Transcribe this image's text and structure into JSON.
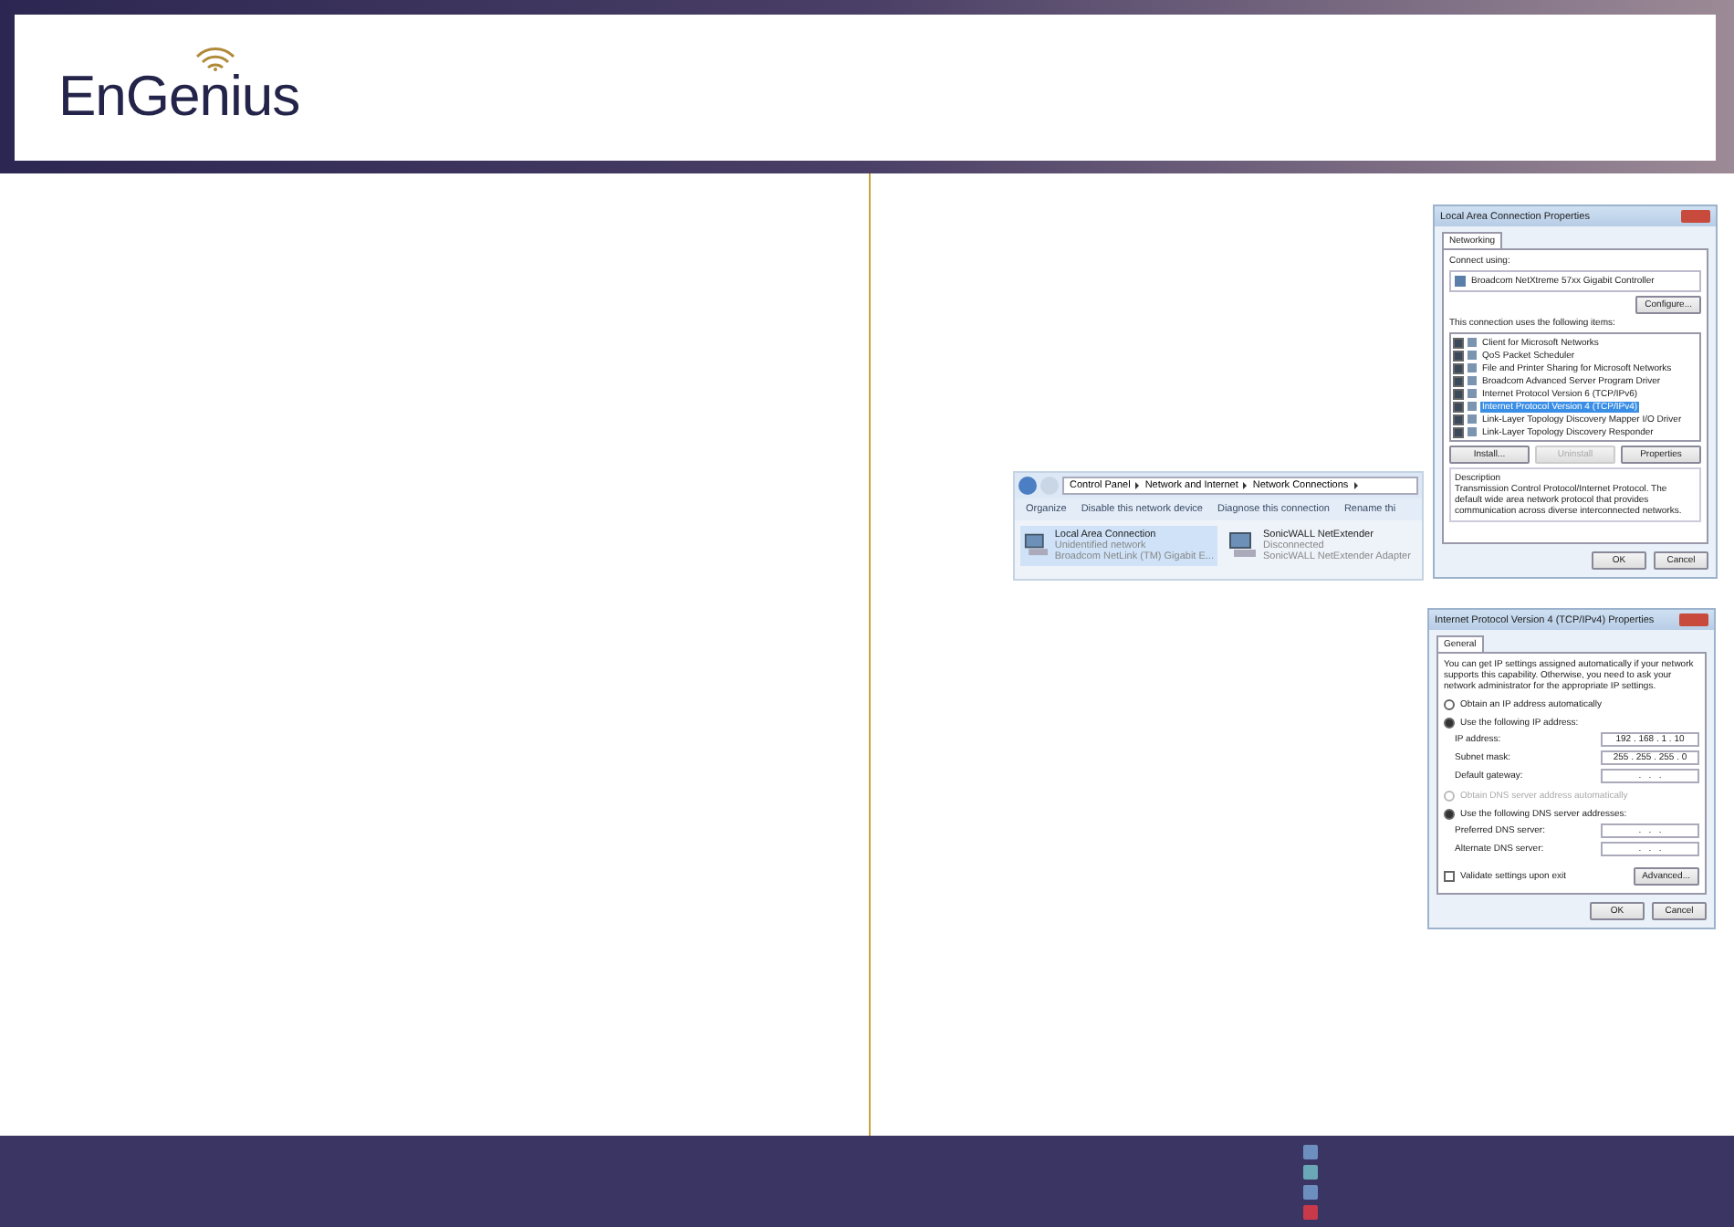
{
  "header": {
    "logo": "EnGenius"
  },
  "network_connections": {
    "breadcrumb": [
      "Control Panel",
      "Network and Internet",
      "Network Connections"
    ],
    "toolbar": [
      "Organize",
      "Disable this network device",
      "Diagnose this connection",
      "Rename thi"
    ],
    "connections": [
      {
        "name": "Local Area Connection",
        "status": "Unidentified network",
        "adapter": "Broadcom NetLink (TM) Gigabit E...",
        "selected": true
      },
      {
        "name": "SonicWALL NetExtender",
        "status": "Disconnected",
        "adapter": "SonicWALL NetExtender Adapter",
        "selected": false
      }
    ]
  },
  "lan_properties": {
    "title": "Local Area Connection Properties",
    "tabs": [
      {
        "label": "Networking",
        "selected": true
      }
    ],
    "connect_using_label": "Connect using:",
    "adapter": "Broadcom NetXtreme 57xx Gigabit Controller",
    "configure_button": "Configure...",
    "items_label": "This connection uses the following items:",
    "items": [
      {
        "label": "Client for Microsoft Networks",
        "checked": true,
        "selected": false
      },
      {
        "label": "QoS Packet Scheduler",
        "checked": true,
        "selected": false
      },
      {
        "label": "File and Printer Sharing for Microsoft Networks",
        "checked": true,
        "selected": false
      },
      {
        "label": "Broadcom Advanced Server Program Driver",
        "checked": true,
        "selected": false
      },
      {
        "label": "Internet Protocol Version 6 (TCP/IPv6)",
        "checked": true,
        "selected": false
      },
      {
        "label": "Internet Protocol Version 4 (TCP/IPv4)",
        "checked": true,
        "selected": true
      },
      {
        "label": "Link-Layer Topology Discovery Mapper I/O Driver",
        "checked": true,
        "selected": false
      },
      {
        "label": "Link-Layer Topology Discovery Responder",
        "checked": true,
        "selected": false
      }
    ],
    "buttons": [
      {
        "label": "Install...",
        "disabled": false
      },
      {
        "label": "Uninstall",
        "disabled": true
      },
      {
        "label": "Properties",
        "disabled": false
      }
    ],
    "description_label": "Description",
    "description": "Transmission Control Protocol/Internet Protocol. The default wide area network protocol that provides communication across diverse interconnected networks.",
    "footer_buttons": [
      "OK",
      "Cancel"
    ]
  },
  "ipv4_properties": {
    "title": "Internet Protocol Version 4 (TCP/IPv4) Properties",
    "tabs": [
      {
        "label": "General",
        "selected": true
      }
    ],
    "intro": "You can get IP settings assigned automatically if your network supports this capability. Otherwise, you need to ask your network administrator for the appropriate IP settings.",
    "ip_options": [
      {
        "label": "Obtain an IP address automatically",
        "selected": false,
        "disabled": false
      },
      {
        "label": "Use the following IP address:",
        "selected": true,
        "disabled": false
      }
    ],
    "ip_fields": [
      {
        "label": "IP address:",
        "value": "192 . 168 . 1 . 10"
      },
      {
        "label": "Subnet mask:",
        "value": "255 . 255 . 255 . 0"
      },
      {
        "label": "Default gateway:",
        "value": ".   .   ."
      }
    ],
    "dns_options": [
      {
        "label": "Obtain DNS server address automatically",
        "selected": false,
        "disabled": true
      },
      {
        "label": "Use the following DNS server addresses:",
        "selected": true,
        "disabled": false
      }
    ],
    "dns_fields": [
      {
        "label": "Preferred DNS server:",
        "value": ".   .   ."
      },
      {
        "label": "Alternate DNS server:",
        "value": ".   .   ."
      }
    ],
    "validate": {
      "label": "Validate settings upon exit",
      "checked": false
    },
    "advanced_button": "Advanced...",
    "footer_buttons": [
      "OK",
      "Cancel"
    ]
  }
}
